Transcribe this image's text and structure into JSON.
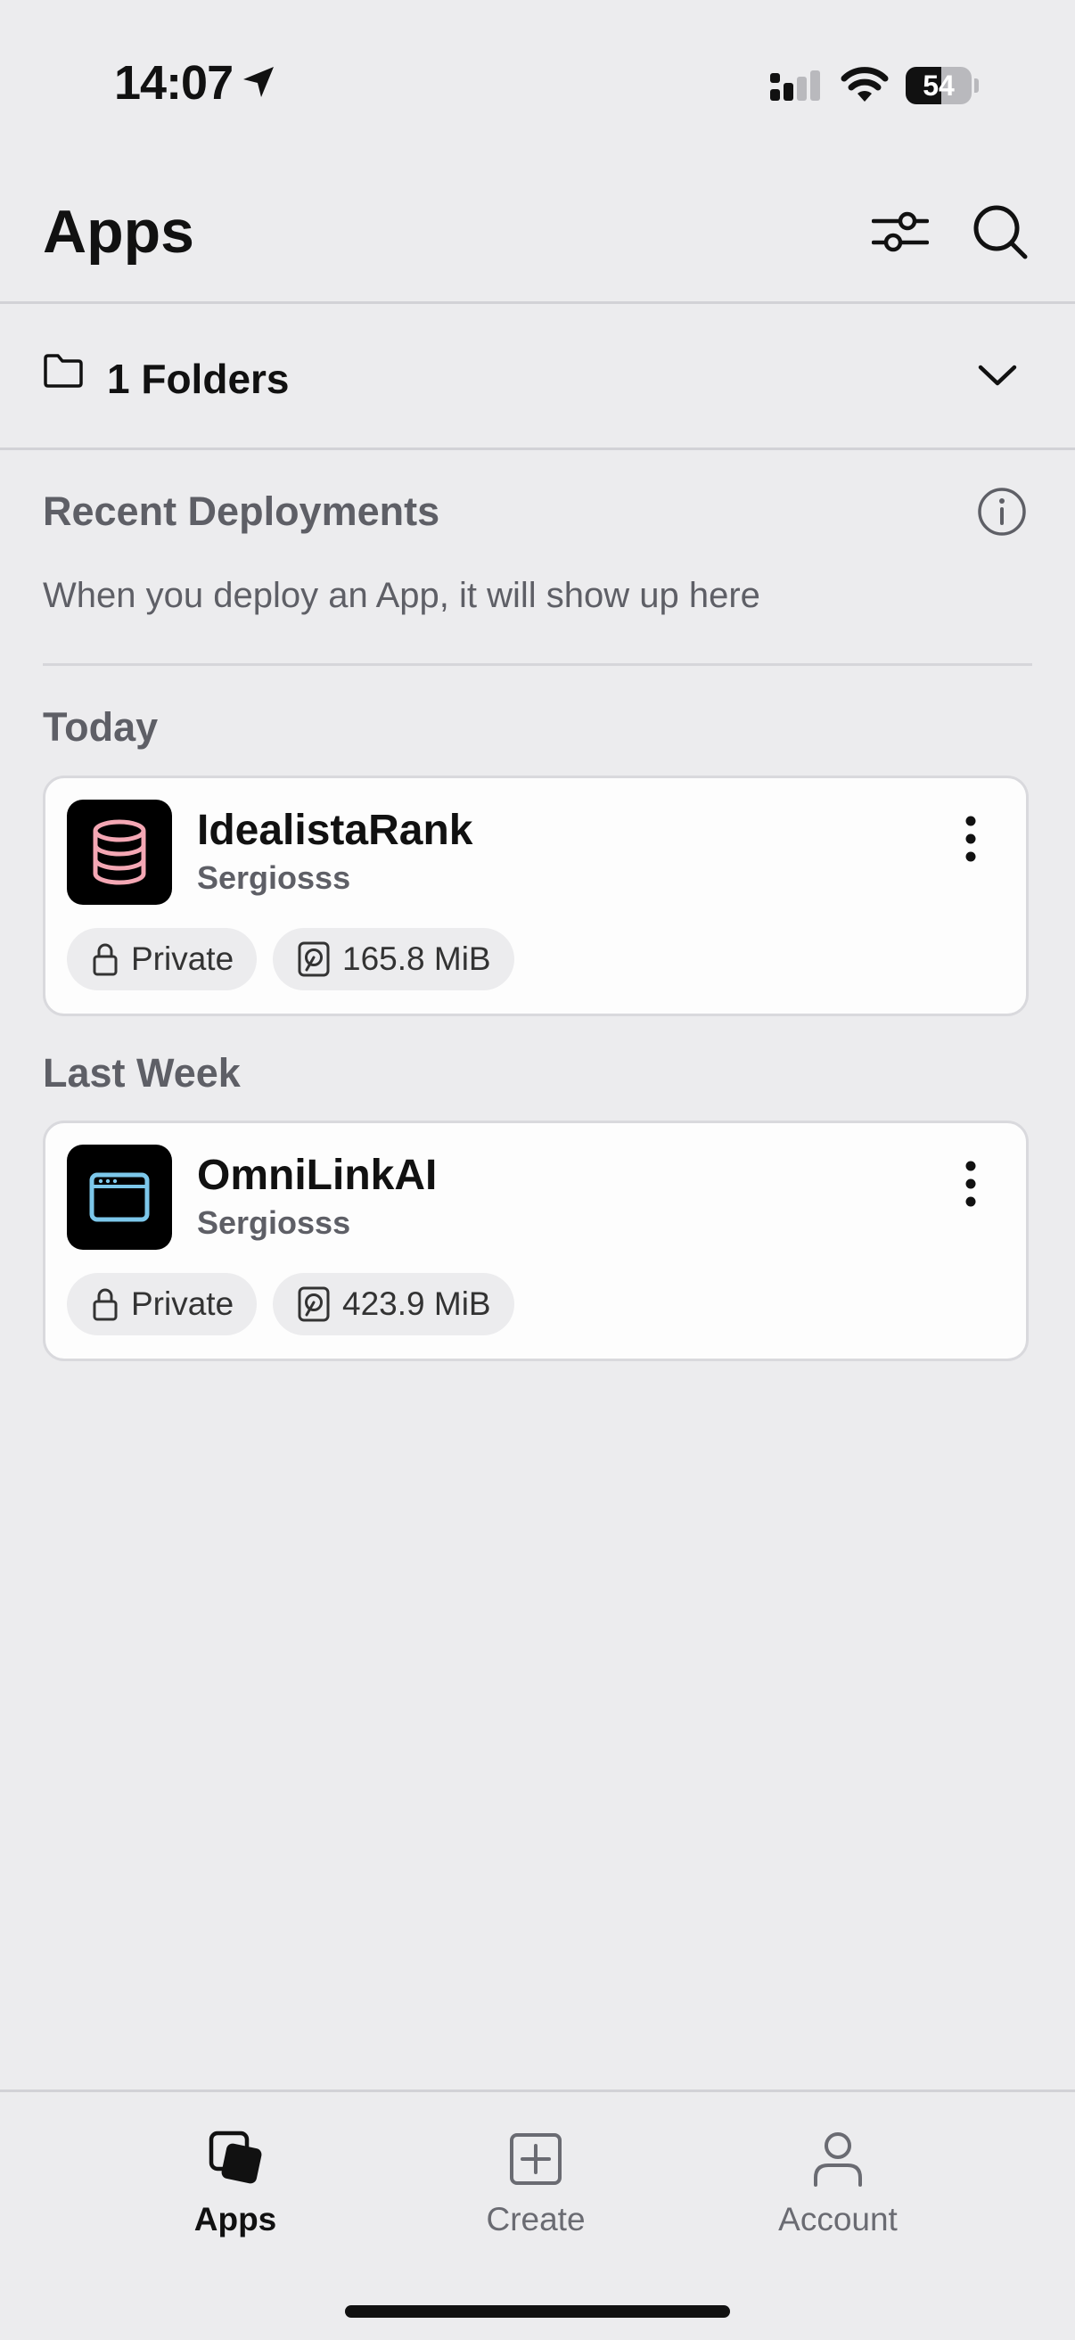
{
  "status_bar": {
    "time": "14:07",
    "battery_percent": "54",
    "battery_level": 0.54
  },
  "header": {
    "title": "Apps",
    "filter_icon": "sliders-icon",
    "search_icon": "search-icon"
  },
  "folders": {
    "label": "1 Folders",
    "icon": "folder-icon",
    "toggle_icon": "chevron-down-icon"
  },
  "recent_deployments": {
    "title": "Recent Deployments",
    "empty_message": "When you deploy an App, it will show up here",
    "info_icon": "info-icon"
  },
  "sections": [
    {
      "label": "Today",
      "apps": [
        {
          "name": "IdealistaRank",
          "owner": "Sergiosss",
          "visibility": "Private",
          "size": "165.8 MiB",
          "icon": "database-icon",
          "icon_color": "#f4a7b4"
        }
      ]
    },
    {
      "label": "Last Week",
      "apps": [
        {
          "name": "OmniLinkAI",
          "owner": "Sergiosss",
          "visibility": "Private",
          "size": "423.9 MiB",
          "icon": "browser-window-icon",
          "icon_color": "#7cc7ea"
        }
      ]
    }
  ],
  "bottom_nav": {
    "items": [
      {
        "label": "Apps",
        "icon": "apps-stack-icon",
        "active": true
      },
      {
        "label": "Create",
        "icon": "plus-square-icon",
        "active": false
      },
      {
        "label": "Account",
        "icon": "person-icon",
        "active": false
      }
    ]
  },
  "colors": {
    "background": "#ececee",
    "card": "#fdfdfd",
    "muted_text": "#5e5f66",
    "divider": "#d2d2d6"
  }
}
